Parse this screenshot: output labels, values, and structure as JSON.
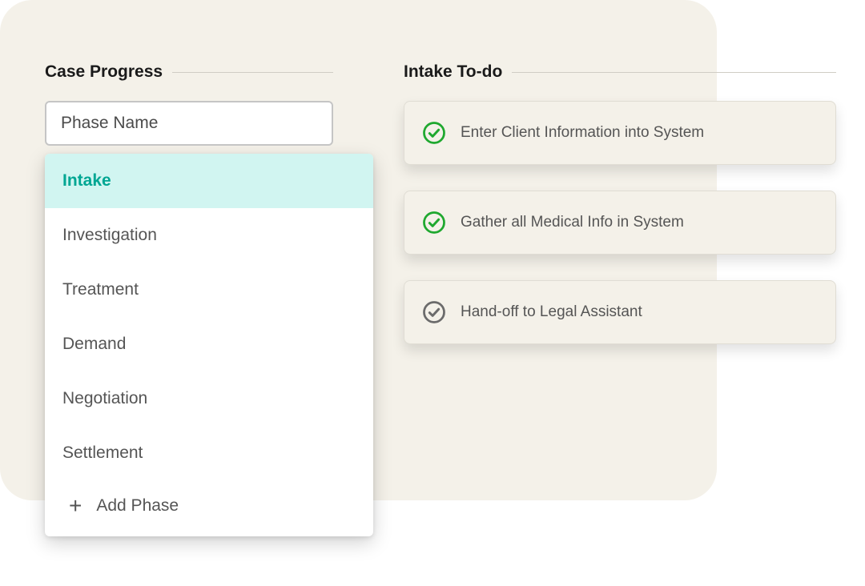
{
  "caseProgress": {
    "title": "Case Progress",
    "inputPlaceholder": "Phase Name",
    "phases": [
      {
        "label": "Intake",
        "active": true
      },
      {
        "label": "Investigation",
        "active": false
      },
      {
        "label": "Treatment",
        "active": false
      },
      {
        "label": "Demand",
        "active": false
      },
      {
        "label": "Negotiation",
        "active": false
      },
      {
        "label": "Settlement",
        "active": false
      }
    ],
    "addPhaseLabel": "Add Phase"
  },
  "todo": {
    "title": "Intake To-do",
    "items": [
      {
        "label": "Enter Client Information into System",
        "done": true
      },
      {
        "label": "Gather all Medical Info in System",
        "done": true
      },
      {
        "label": "Hand-off to Legal Assistant",
        "done": false
      }
    ]
  },
  "colors": {
    "accent": "#00a693",
    "doneCheck": "#1fa82f",
    "pendingCheck": "#6b6b6b"
  }
}
